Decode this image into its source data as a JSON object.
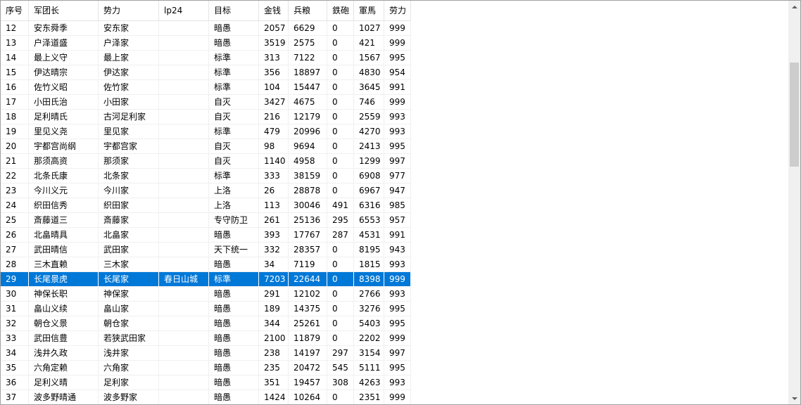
{
  "table": {
    "columns": [
      "序号",
      "军团长",
      "势力",
      "lp24",
      "目标",
      "金钱",
      "兵粮",
      "鉄砲",
      "軍馬",
      "劳力"
    ],
    "rows": [
      [
        "12",
        "安东舜季",
        "安东家",
        "",
        "暗愚",
        "2057",
        "6629",
        "0",
        "1027",
        "999"
      ],
      [
        "13",
        "户泽道盛",
        "户泽家",
        "",
        "暗愚",
        "3519",
        "2575",
        "0",
        "421",
        "999"
      ],
      [
        "14",
        "最上义守",
        "最上家",
        "",
        "标準",
        "313",
        "7122",
        "0",
        "1567",
        "995"
      ],
      [
        "15",
        "伊达晴宗",
        "伊达家",
        "",
        "标準",
        "356",
        "18897",
        "0",
        "4830",
        "954"
      ],
      [
        "16",
        "佐竹义昭",
        "佐竹家",
        "",
        "标準",
        "104",
        "15447",
        "0",
        "3645",
        "991"
      ],
      [
        "17",
        "小田氏治",
        "小田家",
        "",
        "自灭",
        "3427",
        "4675",
        "0",
        "746",
        "999"
      ],
      [
        "18",
        "足利晴氏",
        "古河足利家",
        "",
        "自灭",
        "216",
        "12179",
        "0",
        "2559",
        "993"
      ],
      [
        "19",
        "里见义尧",
        "里见家",
        "",
        "标準",
        "479",
        "20996",
        "0",
        "4270",
        "993"
      ],
      [
        "20",
        "宇都宫尚纲",
        "宇都宫家",
        "",
        "自灭",
        "98",
        "9694",
        "0",
        "2413",
        "995"
      ],
      [
        "21",
        "那须高资",
        "那须家",
        "",
        "自灭",
        "1140",
        "4958",
        "0",
        "1299",
        "997"
      ],
      [
        "22",
        "北条氏康",
        "北条家",
        "",
        "标準",
        "333",
        "38159",
        "0",
        "6908",
        "977"
      ],
      [
        "23",
        "今川义元",
        "今川家",
        "",
        "上洛",
        "26",
        "28878",
        "0",
        "6967",
        "947"
      ],
      [
        "24",
        "织田信秀",
        "织田家",
        "",
        "上洛",
        "113",
        "30046",
        "491",
        "6316",
        "985"
      ],
      [
        "25",
        "斎藤道三",
        "斎藤家",
        "",
        "专守防卫",
        "261",
        "25136",
        "295",
        "6553",
        "957"
      ],
      [
        "26",
        "北畠晴具",
        "北畠家",
        "",
        "暗愚",
        "393",
        "17767",
        "287",
        "4531",
        "991"
      ],
      [
        "27",
        "武田晴信",
        "武田家",
        "",
        "天下统一",
        "332",
        "28357",
        "0",
        "8195",
        "943"
      ],
      [
        "28",
        "三木直赖",
        "三木家",
        "",
        "暗愚",
        "34",
        "7119",
        "0",
        "1815",
        "993"
      ],
      [
        "29",
        "长尾景虎",
        "长尾家",
        "春日山城",
        "标準",
        "7203",
        "22644",
        "0",
        "8398",
        "999"
      ],
      [
        "30",
        "神保长职",
        "神保家",
        "",
        "暗愚",
        "291",
        "12102",
        "0",
        "2766",
        "993"
      ],
      [
        "31",
        "畠山义续",
        "畠山家",
        "",
        "暗愚",
        "189",
        "14375",
        "0",
        "3276",
        "995"
      ],
      [
        "32",
        "朝仓义景",
        "朝仓家",
        "",
        "暗愚",
        "344",
        "25261",
        "0",
        "5403",
        "995"
      ],
      [
        "33",
        "武田信豊",
        "若狭武田家",
        "",
        "暗愚",
        "2100",
        "11879",
        "0",
        "2202",
        "999"
      ],
      [
        "34",
        "浅井久政",
        "浅井家",
        "",
        "暗愚",
        "238",
        "14197",
        "297",
        "3154",
        "997"
      ],
      [
        "35",
        "六角定赖",
        "六角家",
        "",
        "暗愚",
        "235",
        "20472",
        "545",
        "5111",
        "995"
      ],
      [
        "36",
        "足利义晴",
        "足利家",
        "",
        "暗愚",
        "351",
        "19457",
        "308",
        "4263",
        "993"
      ],
      [
        "37",
        "波多野晴通",
        "波多野家",
        "",
        "暗愚",
        "1424",
        "10264",
        "0",
        "2351",
        "999"
      ]
    ],
    "selected_row_id": "29"
  },
  "colors": {
    "selection": "#0078d7",
    "grid_line": "#f0f0f0",
    "scrollbar_track": "#f0f0f0",
    "scrollbar_thumb": "#cdcdcd"
  },
  "icons": {
    "scroll_up": "scroll-up-arrow-icon",
    "scroll_down": "scroll-down-arrow-icon"
  }
}
